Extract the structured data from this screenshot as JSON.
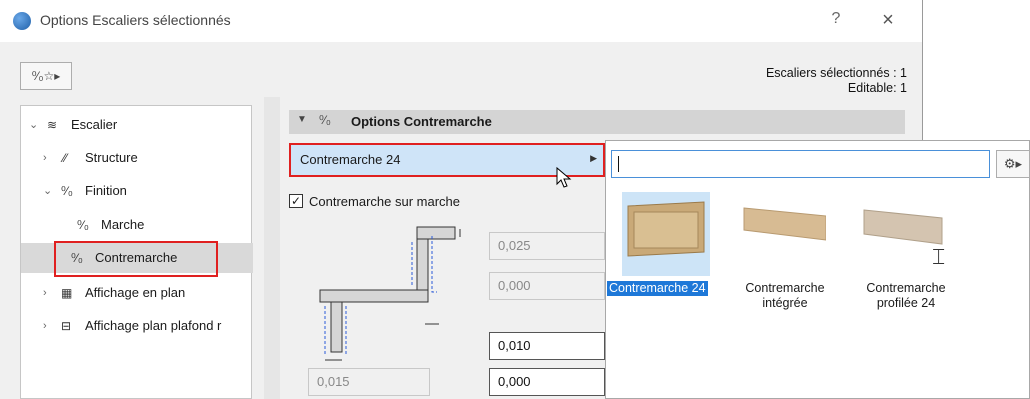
{
  "dialog": {
    "title": "Options Escaliers sélectionnés",
    "help_label": "?",
    "close_label": "×",
    "favorites_icon": "favorites-star-icon",
    "info_selected": "Escaliers sélectionnés : 1",
    "info_editable": "Editable: 1"
  },
  "tree": {
    "items": [
      {
        "label": "Escalier",
        "icon": "stair-icon",
        "chevron": "expanded"
      },
      {
        "label": "Structure",
        "icon": "structure-icon",
        "chevron": "collapsed"
      },
      {
        "label": "Finition",
        "icon": "finish-icon",
        "chevron": "expanded"
      },
      {
        "label": "Marche",
        "icon": "tread-icon"
      },
      {
        "label": "Contremarche",
        "icon": "riser-icon",
        "selected": true
      },
      {
        "label": "Affichage en plan",
        "icon": "floor-plan-icon",
        "chevron": "collapsed"
      },
      {
        "label": "Affichage plan plafond r",
        "icon": "ceiling-plan-icon",
        "chevron": "collapsed"
      }
    ]
  },
  "section": {
    "title": "Options Contremarche",
    "icon": "riser-icon"
  },
  "dropdown": {
    "value": "Contremarche 24"
  },
  "checkbox": {
    "label": "Contremarche sur marche",
    "checked": true
  },
  "fields": {
    "f1": "0,025",
    "f2": "0,000",
    "f3": "0,010",
    "f4": "0,000",
    "f5": "0,015"
  },
  "popup": {
    "search_value": "",
    "items": [
      {
        "line1": "Contremarche 24",
        "line2": "",
        "selected": true
      },
      {
        "line1": "Contremarche",
        "line2": "intégrée",
        "selected": false
      },
      {
        "line1": "Contremarche",
        "line2": "profilée 24",
        "selected": false
      }
    ]
  },
  "colors": {
    "accent": "#1e78d8",
    "highlight_border": "#e02020",
    "selection_bg": "#cde4f7"
  }
}
